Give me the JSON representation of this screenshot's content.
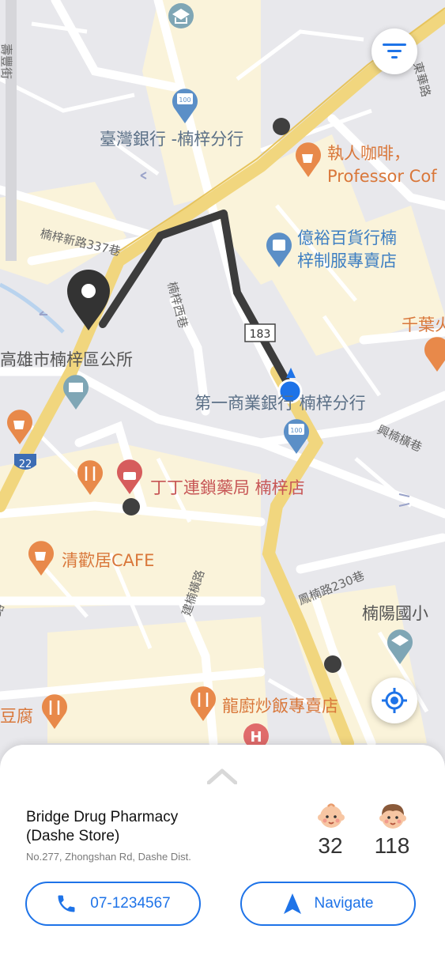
{
  "map": {
    "labels": {
      "bank_of_taiwan": "臺灣銀行 -楠梓分行",
      "cafe_professor_1": "執人咖啡，",
      "cafe_professor_2": "Professor Cof",
      "dept_store_1": "億裕百貨行楠",
      "dept_store_2": "梓制服專賣店",
      "road_new_337": "楠梓新路337巷",
      "road_west": "楠梓西巷",
      "route_badge": "183",
      "district_office": "高雄市楠梓區公所",
      "first_bank": "第一商業銀行 楠梓分行",
      "xing_nan_heng": "興楠橫巷",
      "pharmacy_label": "丁丁連鎖藥局 楠梓店",
      "qinghuanju": "清歡居CAFE",
      "jian_nan_road": "建楠橫路",
      "feng_nan_road": "鳳楠路230巷",
      "elementary_school": "楠陽國小",
      "fried_rice": "龍廚炒飯專賣店",
      "tofu": "豆腐",
      "east_street": "東華路",
      "qianye": "千葉火",
      "route_22": "22",
      "left_street": "壽豐街",
      "road_lu": "路"
    }
  },
  "place": {
    "name_line1": "Bridge Drug Pharmacy",
    "name_line2": "(Dashe Store)",
    "address": "No.277, Zhongshan Rd, Dashe Dist.",
    "infant_count": "32",
    "child_count": "118",
    "phone": "07-1234567",
    "navigate_label": "Navigate"
  },
  "icons": {
    "filter": "filter-icon",
    "locate": "my-location-icon",
    "infant": "baby-face-icon",
    "child": "child-face-icon",
    "phone": "phone-icon",
    "navigate": "navigation-arrow-icon"
  },
  "colors": {
    "accent": "#1e73e8",
    "route": "#3c3c3c",
    "poi_orange": "#e8894a",
    "poi_blue": "#5b8fc7",
    "road_yellow": "#f1d67e"
  }
}
